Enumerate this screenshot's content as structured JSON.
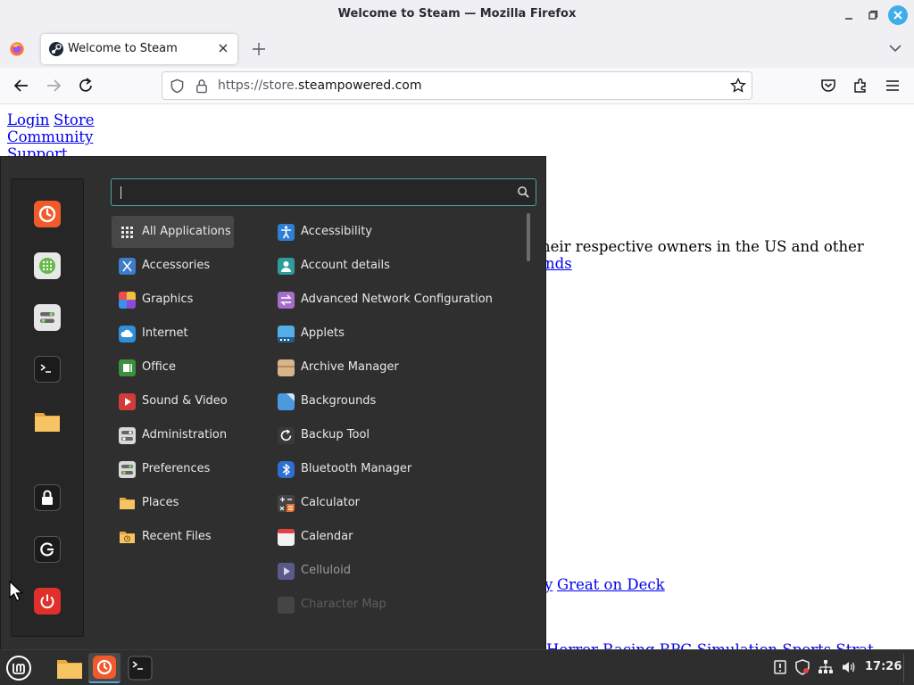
{
  "window": {
    "title": "Welcome to Steam — Mozilla Firefox"
  },
  "tabs": [
    {
      "label": "Welcome to Steam"
    }
  ],
  "address_bar": {
    "url_prefix": "https://store.",
    "url_domain": "steampowered.com"
  },
  "page": {
    "links": {
      "login": "Login",
      "store": "Store",
      "community": "Community",
      "support": "Support",
      "friends_fragment": "nds",
      "y_fragment": "y",
      "great_on_deck": "Great on Deck"
    },
    "text": {
      "trademark_fragment": "heir respective owners in the US and other",
      "bottom_fragment": "Horror   Racing   RPG   Simulation   Sports   Strat"
    }
  },
  "menu": {
    "search": {
      "placeholder": "",
      "value": ""
    },
    "favorites": [
      {
        "name": "firefox-icon",
        "label": "Firefox"
      },
      {
        "name": "software-manager-icon",
        "label": "Software Manager"
      },
      {
        "name": "system-settings-icon",
        "label": "System Settings"
      },
      {
        "name": "terminal-icon",
        "label": "Terminal"
      },
      {
        "name": "files-icon",
        "label": "Files"
      }
    ],
    "session": [
      {
        "name": "lock-screen-icon",
        "label": "Lock Screen"
      },
      {
        "name": "logout-icon",
        "label": "Logout"
      },
      {
        "name": "quit-icon",
        "label": "Quit"
      }
    ],
    "categories": [
      {
        "label": "All Applications",
        "icon": "grid-icon",
        "color": "#3a3a3a",
        "selected": true
      },
      {
        "label": "Accessories",
        "icon": "scissors-icon",
        "color": "#3d7cc9"
      },
      {
        "label": "Graphics",
        "icon": "palette-icon",
        "color": "#d46a6a"
      },
      {
        "label": "Internet",
        "icon": "cloud-icon",
        "color": "#2f8fd8"
      },
      {
        "label": "Office",
        "icon": "document-icon",
        "color": "#3e8e3e"
      },
      {
        "label": "Sound & Video",
        "icon": "play-icon",
        "color": "#d33a3a"
      },
      {
        "label": "Administration",
        "icon": "toggle-icon",
        "color": "#d9d9d9"
      },
      {
        "label": "Preferences",
        "icon": "toggle-icon",
        "color": "#d9d9d9"
      },
      {
        "label": "Places",
        "icon": "folder-icon",
        "color": "#e9b44c"
      },
      {
        "label": "Recent Files",
        "icon": "folder-clock-icon",
        "color": "#e9b44c"
      }
    ],
    "applications": [
      {
        "label": "Accessibility",
        "icon": "accessibility-icon",
        "color": "#2f7fd4"
      },
      {
        "label": "Account details",
        "icon": "user-icon",
        "color": "#2f9b9b"
      },
      {
        "label": "Advanced Network Configuration",
        "icon": "network-icon",
        "color": "#a46ec9"
      },
      {
        "label": "Applets",
        "icon": "applets-icon",
        "color": "#56aee8"
      },
      {
        "label": "Archive Manager",
        "icon": "archive-icon",
        "color": "#d9b48a"
      },
      {
        "label": "Backgrounds",
        "icon": "backgrounds-icon",
        "color": "#4b9ae0"
      },
      {
        "label": "Backup Tool",
        "icon": "backup-icon",
        "color": "#3a3a3a"
      },
      {
        "label": "Bluetooth Manager",
        "icon": "bluetooth-icon",
        "color": "#2e6fd1"
      },
      {
        "label": "Calculator",
        "icon": "calculator-icon",
        "color": "#444444"
      },
      {
        "label": "Calendar",
        "icon": "calendar-icon",
        "color": "#f2f2f2"
      },
      {
        "label": "Celluloid",
        "icon": "celluloid-icon",
        "color": "#5a5a8a"
      },
      {
        "label": "Character Map",
        "icon": "charmap-icon",
        "color": "#888888"
      }
    ]
  },
  "taskbar": {
    "apps": [
      {
        "name": "taskbar-files-icon",
        "label": "Files"
      },
      {
        "name": "taskbar-firefox-icon",
        "label": "Firefox"
      },
      {
        "name": "taskbar-terminal-icon",
        "label": "Terminal"
      }
    ],
    "clock": "17:26"
  },
  "colors": {
    "accent": "#4aa7a2",
    "menu_bg": "#2f2f2f",
    "panel_bg": "#2e2e2e",
    "link": "#0000ee"
  }
}
